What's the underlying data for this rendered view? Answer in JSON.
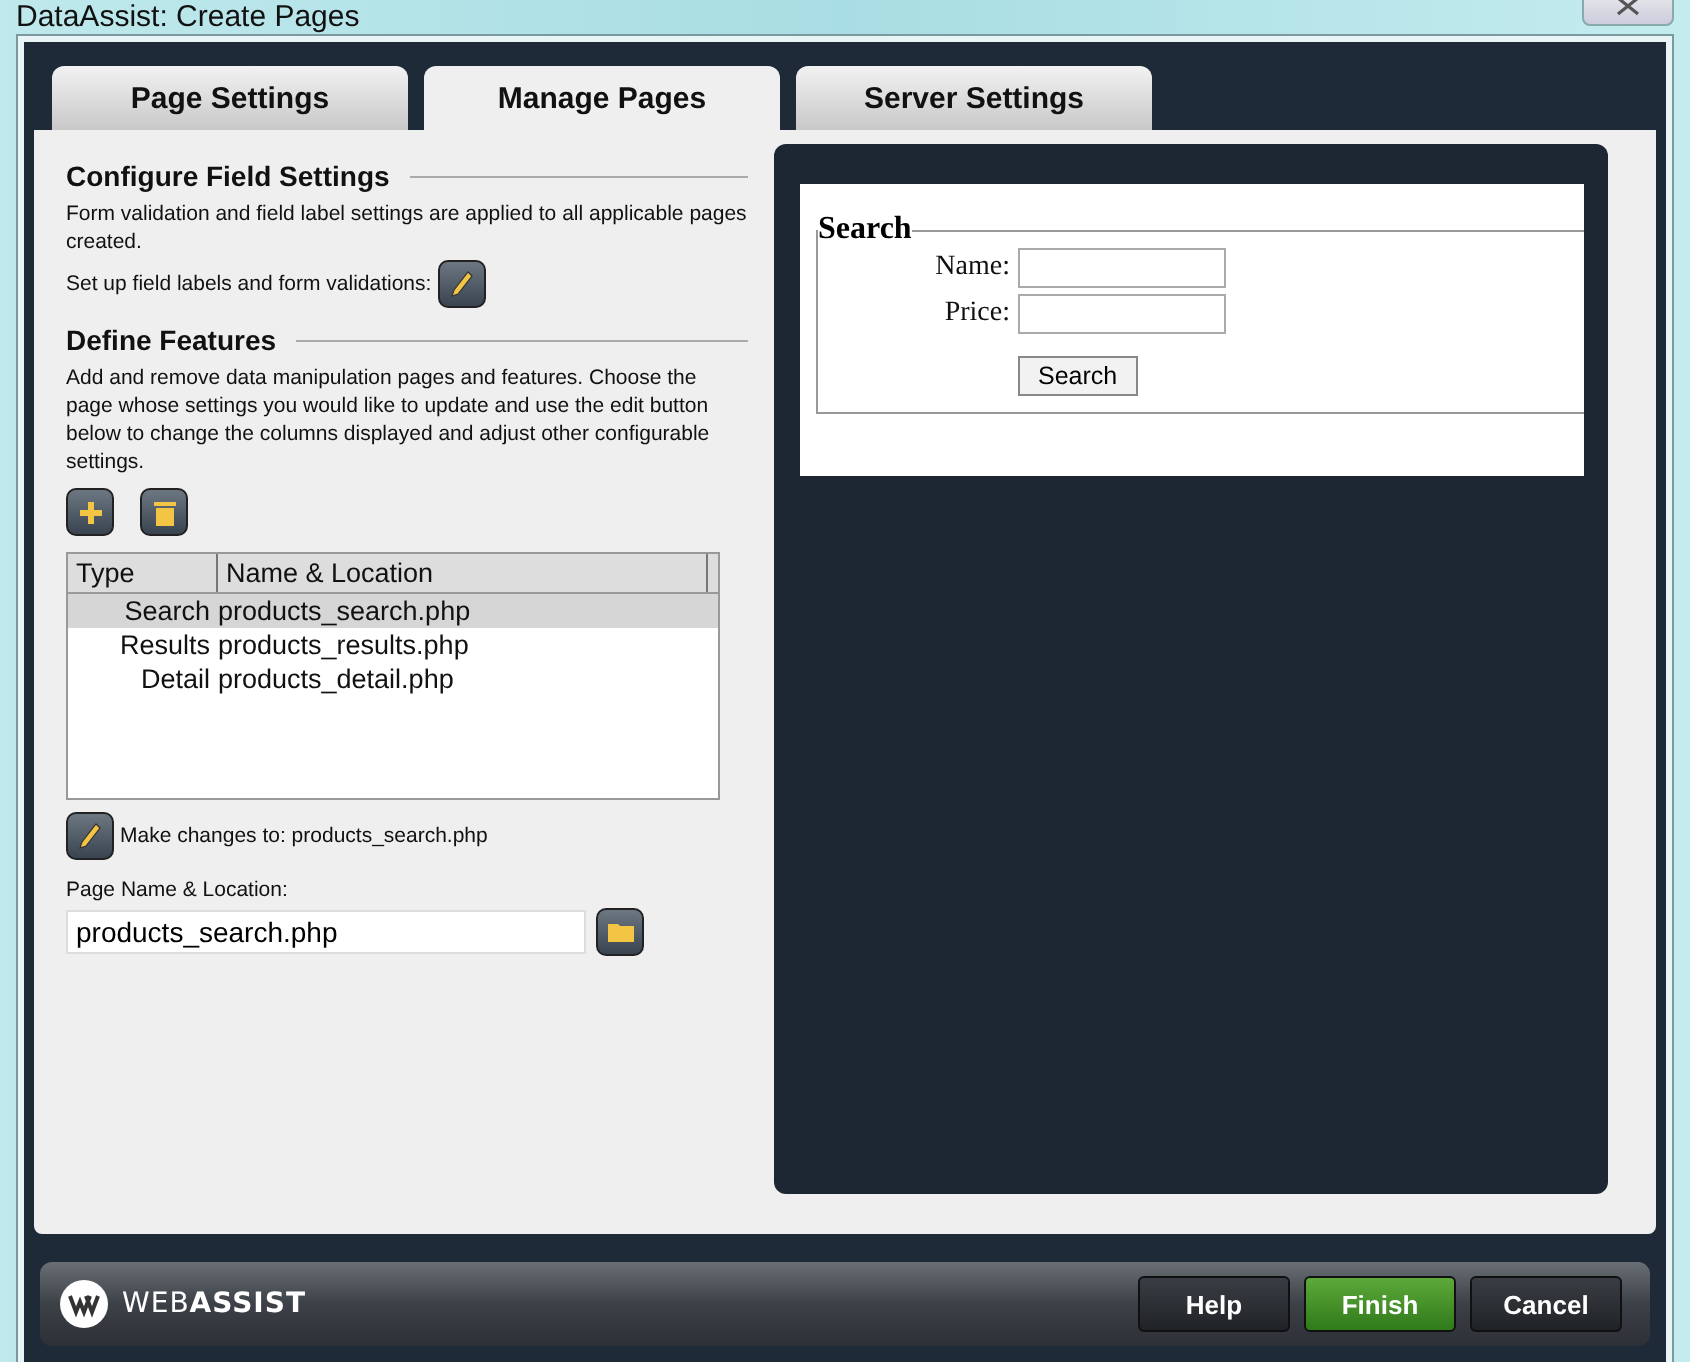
{
  "window": {
    "title": "DataAssist: Create Pages"
  },
  "tabs": [
    {
      "label": "Page Settings",
      "selected": false
    },
    {
      "label": "Manage Pages",
      "selected": true
    },
    {
      "label": "Server Settings",
      "selected": false
    }
  ],
  "field_settings": {
    "heading": "Configure Field Settings",
    "description": "Form validation and field label settings are applied to all applicable pages created.",
    "edit_label": "Set up field labels and form validations:"
  },
  "features": {
    "heading": "Define Features",
    "description": "Add and remove data manipulation pages and features. Choose the page whose settings you would like to update and use the edit button below to change the columns displayed and adjust other configurable settings."
  },
  "table": {
    "columns": [
      "Type",
      "Name & Location"
    ],
    "rows": [
      {
        "type": "Search",
        "name": "products_search.php",
        "selected": true
      },
      {
        "type": "Results",
        "name": "products_results.php",
        "selected": false
      },
      {
        "type": "Detail",
        "name": "products_detail.php",
        "selected": false
      }
    ]
  },
  "edit_target": "Make changes to: products_search.php",
  "page_name": {
    "label": "Page Name & Location:",
    "value": "products_search.php"
  },
  "preview": {
    "legend": "Search",
    "fields": [
      "Name:",
      "Price:"
    ],
    "button": "Search"
  },
  "footer": {
    "logo": "WEB**ASSIST**",
    "buttons": [
      {
        "label": "Help",
        "kind": "normal"
      },
      {
        "label": "Finish",
        "kind": "primary"
      },
      {
        "label": "Cancel",
        "kind": "normal"
      }
    ]
  }
}
